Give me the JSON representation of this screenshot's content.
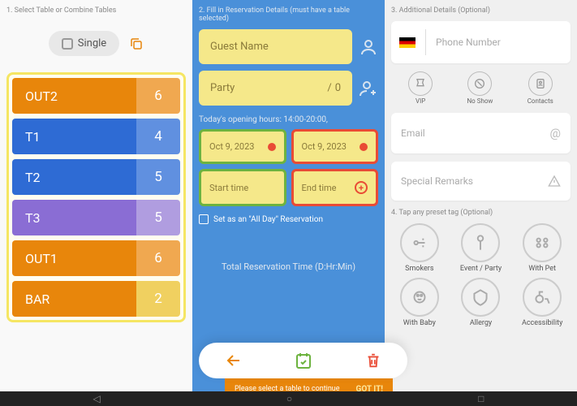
{
  "col1": {
    "title": "1. Select Table or Combine Tables",
    "single_label": "Single",
    "tables": [
      {
        "name": "OUT2",
        "count": "6",
        "color": "#e8860b",
        "light": "#f0a850"
      },
      {
        "name": "T1",
        "count": "4",
        "color": "#2e6bd4",
        "light": "#6090e0"
      },
      {
        "name": "T2",
        "count": "5",
        "color": "#2e6bd4",
        "light": "#6090e0"
      },
      {
        "name": "T3",
        "count": "5",
        "color": "#8a6dd4",
        "light": "#b09de0"
      },
      {
        "name": "OUT1",
        "count": "6",
        "color": "#e8860b",
        "light": "#f0a850"
      },
      {
        "name": "BAR",
        "count": "2",
        "color": "#e8860b",
        "light": "#f0d060"
      }
    ]
  },
  "col2": {
    "title": "2. Fill in Reservation Details (must have a table selected)",
    "guest_ph": "Guest Name",
    "party_label": "Party",
    "party_count": "0",
    "hours": "Today's opening hours: 14:00-20:00,",
    "start_date": "Oct 9, 2023",
    "end_date": "Oct 9, 2023",
    "start_time": "Start time",
    "end_time": "End time",
    "allday": "Set as an \"All Day\" Reservation",
    "total": "Total Reservation Time (D:Hr:Min)",
    "toast_msg": "Please select a table to continue",
    "toast_btn": "GOT IT!"
  },
  "col3": {
    "title": "3. Additional Details (Optional)",
    "phone_ph": "Phone Number",
    "status_tags": [
      "VIP",
      "No Show",
      "Contacts"
    ],
    "email_ph": "Email",
    "remarks_ph": "Special Remarks",
    "preset_title": "4. Tap any preset tag (Optional)",
    "presets": [
      "Smokers",
      "Event / Party",
      "With Pet",
      "With Baby",
      "Allergy",
      "Accessibility"
    ]
  }
}
